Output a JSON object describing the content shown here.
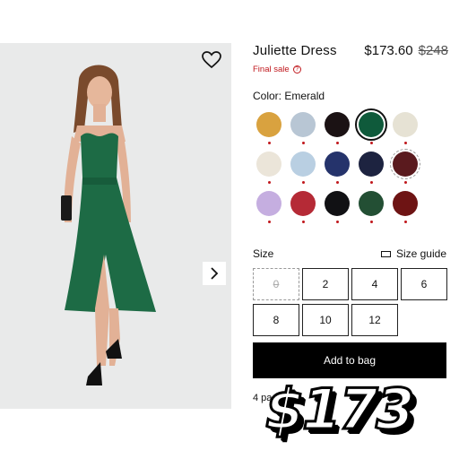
{
  "product": {
    "title": "Juliette Dress",
    "price": "$173.60",
    "original_price": "$248",
    "final_sale": "Final sale",
    "color_label": "Color: Emerald"
  },
  "swatches": [
    {
      "name": "floral-mustard",
      "color": "#d9a23f"
    },
    {
      "name": "pale-blue-floral",
      "color": "#b8c6d4"
    },
    {
      "name": "red-rose-black",
      "color": "#1b1214"
    },
    {
      "name": "emerald",
      "color": "#0f5a3b",
      "selected": true
    },
    {
      "name": "green-floral-white",
      "color": "#e6e2d4"
    },
    {
      "name": "cream",
      "color": "#ebe5d9"
    },
    {
      "name": "light-blue",
      "color": "#b9cfe2"
    },
    {
      "name": "navy-dot",
      "color": "#25336b"
    },
    {
      "name": "navy",
      "color": "#1d2340"
    },
    {
      "name": "burgundy",
      "color": "#5a1a1e",
      "dashed": true
    },
    {
      "name": "lavender-floral",
      "color": "#c5aee0"
    },
    {
      "name": "red-floral",
      "color": "#b52a36"
    },
    {
      "name": "black",
      "color": "#111114"
    },
    {
      "name": "green-floral",
      "color": "#234f34"
    },
    {
      "name": "dark-red-floral",
      "color": "#6e1414"
    }
  ],
  "size": {
    "label": "Size",
    "guide_label": "Size guide",
    "options": [
      "0",
      "2",
      "4",
      "6",
      "8",
      "10",
      "12"
    ],
    "unavailable": [
      "0"
    ]
  },
  "cta": {
    "add_to_bag": "Add to bag"
  },
  "payments_text": "4 pa",
  "overlay_price": "$173"
}
